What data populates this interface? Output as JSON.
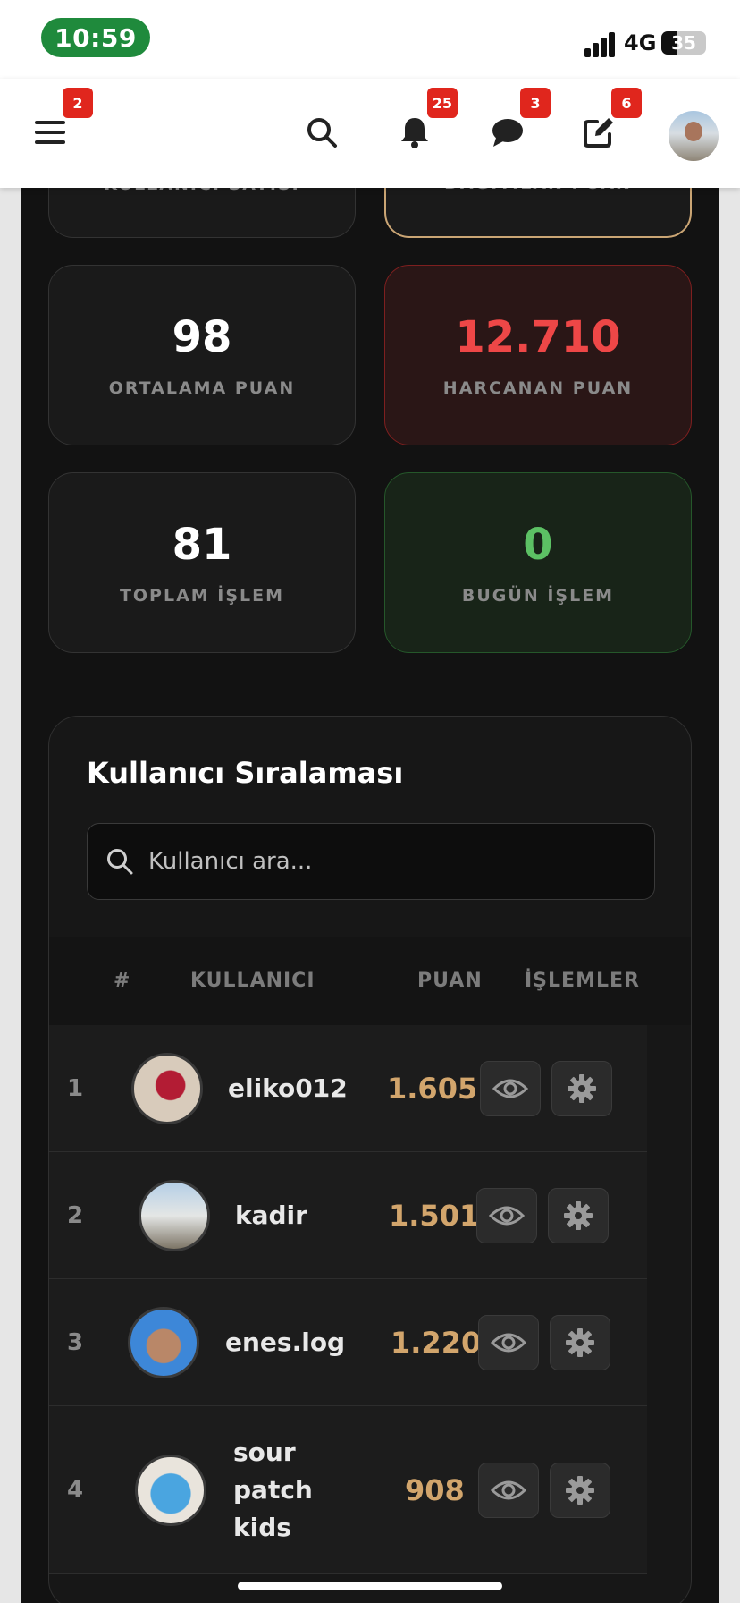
{
  "status_bar": {
    "time": "10:59",
    "network": "4G",
    "battery": "35",
    "battery_level": 0.35
  },
  "header": {
    "menu_badge": "2",
    "notifications_badge": "25",
    "messages_badge": "3",
    "edit_badge": "6"
  },
  "stats": {
    "top_left_label": "KULLANICI SAYISI",
    "top_right_label": "DAĞITILAN PUAN",
    "average": {
      "value": "98",
      "label": "ORTALAMA PUAN"
    },
    "spent": {
      "value": "12.710",
      "label": "HARCANAN PUAN"
    },
    "total_tx": {
      "value": "81",
      "label": "TOPLAM İŞLEM"
    },
    "today_tx": {
      "value": "0",
      "label": "BUGÜN İŞLEM"
    },
    "colors": {
      "spent": "#ee4747",
      "today": "#5cc164",
      "highlight": "#caa574"
    }
  },
  "ranking": {
    "title": "Kullanıcı Sıralaması",
    "search_placeholder": "Kullanıcı ara...",
    "columns": {
      "rank": "#",
      "user": "KULLANICI",
      "points": "PUAN",
      "actions": "İŞLEMLER"
    },
    "rows": [
      {
        "rank": "1",
        "username": "eliko012",
        "points": "1.605"
      },
      {
        "rank": "2",
        "username": "kadir",
        "points": "1.501"
      },
      {
        "rank": "3",
        "username": "enes.log",
        "points": "1.220"
      },
      {
        "rank": "4",
        "username": "sour patch kids",
        "points": "908"
      }
    ],
    "points_color": "#d2a56c"
  }
}
